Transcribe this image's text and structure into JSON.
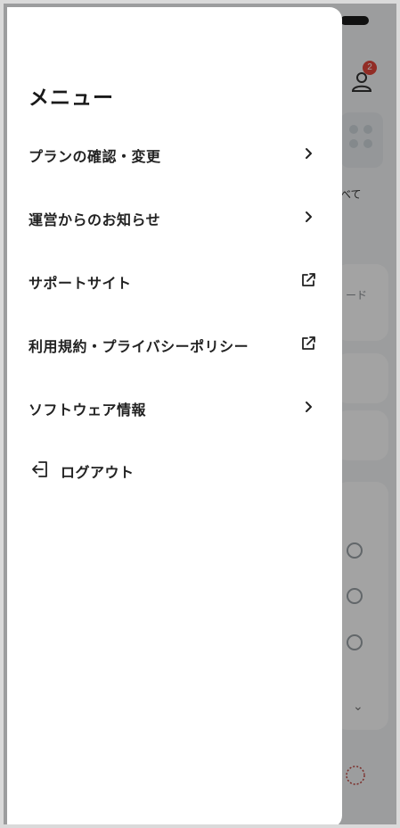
{
  "background": {
    "badge_count": "2",
    "all_label": "べて",
    "card_label": "ード"
  },
  "drawer": {
    "title": "メニュー",
    "items": [
      {
        "label": "プランの確認・変更",
        "icon": "chevron-right-icon"
      },
      {
        "label": "運営からのお知らせ",
        "icon": "chevron-right-icon"
      },
      {
        "label": "サポートサイト",
        "icon": "external-link-icon"
      },
      {
        "label": "利用規約・プライバシーポリシー",
        "icon": "external-link-icon"
      },
      {
        "label": "ソフトウェア情報",
        "icon": "chevron-right-icon"
      }
    ],
    "logout_label": "ログアウト",
    "logout_icon": "logout-icon"
  },
  "colors": {
    "badge": "#e5473c",
    "text": "#222222",
    "overlay": "rgba(0,0,0,0.36)"
  }
}
